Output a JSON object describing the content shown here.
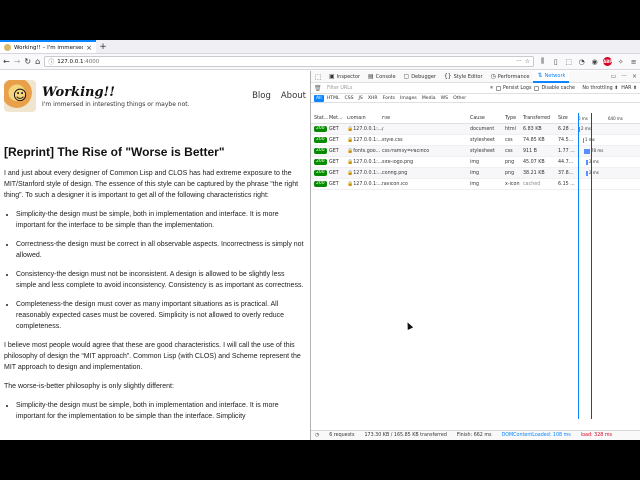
{
  "browser": {
    "tab_title": "Working!! – I'm immersed in inte",
    "url_host": "127.0.0.1",
    "url_port": ":4000"
  },
  "site": {
    "name": "Working!!",
    "tagline": "I'm immersed in interesting things or maybe not.",
    "nav": [
      "Blog",
      "About"
    ]
  },
  "article": {
    "title": "[Reprint] The Rise of \"Worse is Better\"",
    "intro": "I and just about every designer of Common Lisp and CLOS has had extreme exposure to the MIT/Stanford style of design. The essence of this style can be captured by the phrase “the right thing”. To such a designer it is important to get all of the following characteristics right:",
    "list1": [
      "Simplicity-the design must be simple, both in implementation and interface. It is more important for the interface to be simple than the implementation.",
      "Correctness-the design must be correct in all observable aspects. Incorrectness is simply not allowed.",
      "Consistency-the design must not be inconsistent. A design is allowed to be slightly less simple and less complete to avoid inconsistency. Consistency is as important as correctness.",
      "Completeness-the design must cover as many important situations as is practical. All reasonably expected cases must be covered. Simplicity is not allowed to overly reduce completeness."
    ],
    "para2": "I believe most people would agree that these are good characteristics. I will call the use of this philosophy of design the “MIT approach”. Common Lisp (with CLOS) and Scheme represent the MIT approach to design and implementation.",
    "para3": "The worse-is-better philosophy is only slightly different:",
    "list2": [
      "Simplicity-the design must be simple, both in implementation and interface. It is more important for the implementation to be simple than the interface. Simplicity"
    ]
  },
  "devtools": {
    "tabs": [
      {
        "label": "Inspector",
        "icon": "inspector-icon"
      },
      {
        "label": "Console",
        "icon": "console-icon"
      },
      {
        "label": "Debugger",
        "icon": "debugger-icon"
      },
      {
        "label": "Style Editor",
        "icon": "style-editor-icon"
      },
      {
        "label": "Performance",
        "icon": "performance-icon"
      },
      {
        "label": "Network",
        "icon": "network-icon"
      }
    ],
    "filter_placeholder": "Filter URLs",
    "persist_logs": "Persist Logs",
    "disable_cache": "Disable cache",
    "throttling": "No throttling ⬍",
    "har": "HAR ⬍",
    "types": [
      "All",
      "HTML",
      "CSS",
      "JS",
      "XHR",
      "Fonts",
      "Images",
      "Media",
      "WS",
      "Other"
    ],
    "columns": [
      "Stat...",
      "Met...",
      "Domain",
      "File",
      "Cause",
      "Type",
      "Transferred",
      "Size",
      "0 ms",
      "640 ms"
    ],
    "rows": [
      {
        "status": "200",
        "method": "GET",
        "domain": "127.0.0.1:...",
        "file": "/",
        "cause": "document",
        "type": "html",
        "transferred": "6.83 KB",
        "size": "6.28 ...",
        "time": "2 ms"
      },
      {
        "status": "200",
        "method": "GET",
        "domain": "127.0.0.1:...",
        "file": "style.css",
        "cause": "stylesheet",
        "type": "css",
        "transferred": "74.85 KB",
        "size": "74.5...",
        "time": "1 ms"
      },
      {
        "status": "200",
        "method": "GET",
        "domain": "fonts.goo...",
        "file": "css?family=Pacifico",
        "cause": "stylesheet",
        "type": "css",
        "transferred": "911 B",
        "size": "1.77 ...",
        "time": "78 ms"
      },
      {
        "status": "200",
        "method": "GET",
        "domain": "127.0.0.1:...",
        "file": "site-logo.png",
        "cause": "img",
        "type": "png",
        "transferred": "45.07 KB",
        "size": "44.7...",
        "time": "2 ms"
      },
      {
        "status": "200",
        "method": "GET",
        "domain": "127.0.0.1:...",
        "file": "config.png",
        "cause": "img",
        "type": "png",
        "transferred": "38.21 KB",
        "size": "37.8...",
        "time": "2 ms"
      },
      {
        "status": "200",
        "method": "GET",
        "domain": "127.0.0.1:...",
        "file": "favicon.ico",
        "cause": "img",
        "type": "x-icon",
        "transferred": "cached",
        "size": "6.15 ...",
        "time": ""
      }
    ],
    "status_bar": {
      "requests": "6 requests",
      "transferred": "173.30 KB / 165.85 KB transferred",
      "finish": "Finish: 662 ms",
      "dom": "DOMContentLoaded: 108 ms",
      "load": "load: 328 ms"
    }
  }
}
